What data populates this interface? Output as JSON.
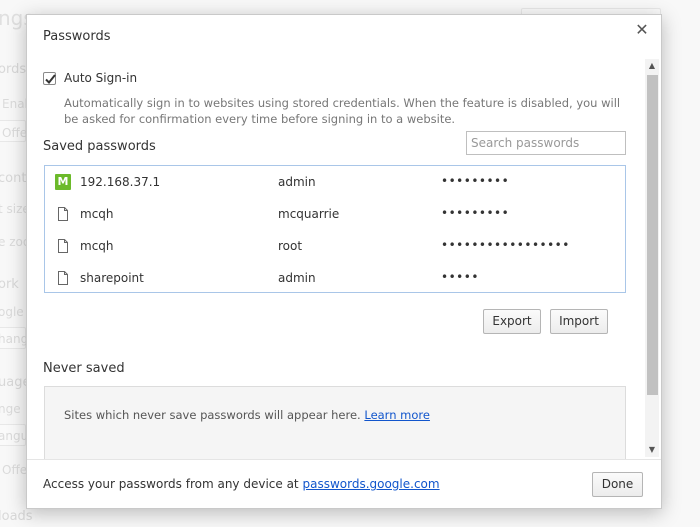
{
  "background": {
    "fragments": [
      "ngs",
      "ords",
      "Enab",
      "Offe",
      "conte",
      "t size",
      "e zoo",
      "ork",
      "ogle C",
      "hange",
      "uage",
      "nge",
      "angu",
      "Offe",
      "loads"
    ]
  },
  "dialog": {
    "title": "Passwords",
    "close_glyph": "✕"
  },
  "auto_signin": {
    "checked": true,
    "label": "Auto Sign-in",
    "description": "Automatically sign in to websites using stored credentials. When the feature is disabled, you will be asked for confirmation every time before signing in to a website."
  },
  "saved_passwords": {
    "title": "Saved passwords",
    "search_placeholder": "Search passwords",
    "rows": [
      {
        "site": "192.168.37.1",
        "username": "admin",
        "password": "•••••••••",
        "icon": "favicon-m-icon"
      },
      {
        "site": "mcqh",
        "username": "mcquarrie",
        "password": "•••••••••",
        "icon": "page-icon"
      },
      {
        "site": "mcqh",
        "username": "root",
        "password": "•••••••••••••••••",
        "icon": "page-icon"
      },
      {
        "site": "sharepoint",
        "username": "admin",
        "password": "•••••",
        "icon": "page-icon"
      }
    ],
    "export_label": "Export",
    "import_label": "Import"
  },
  "never_saved": {
    "title": "Never saved",
    "empty_text": "Sites which never save passwords will appear here.",
    "learn_more": "Learn more"
  },
  "footer": {
    "text": "Access your passwords from any device at",
    "link": "passwords.google.com",
    "done_label": "Done"
  },
  "colors": {
    "accent_link": "#1155cc",
    "list_border": "#a9c6e8",
    "favicon_green": "#6cba2a"
  }
}
